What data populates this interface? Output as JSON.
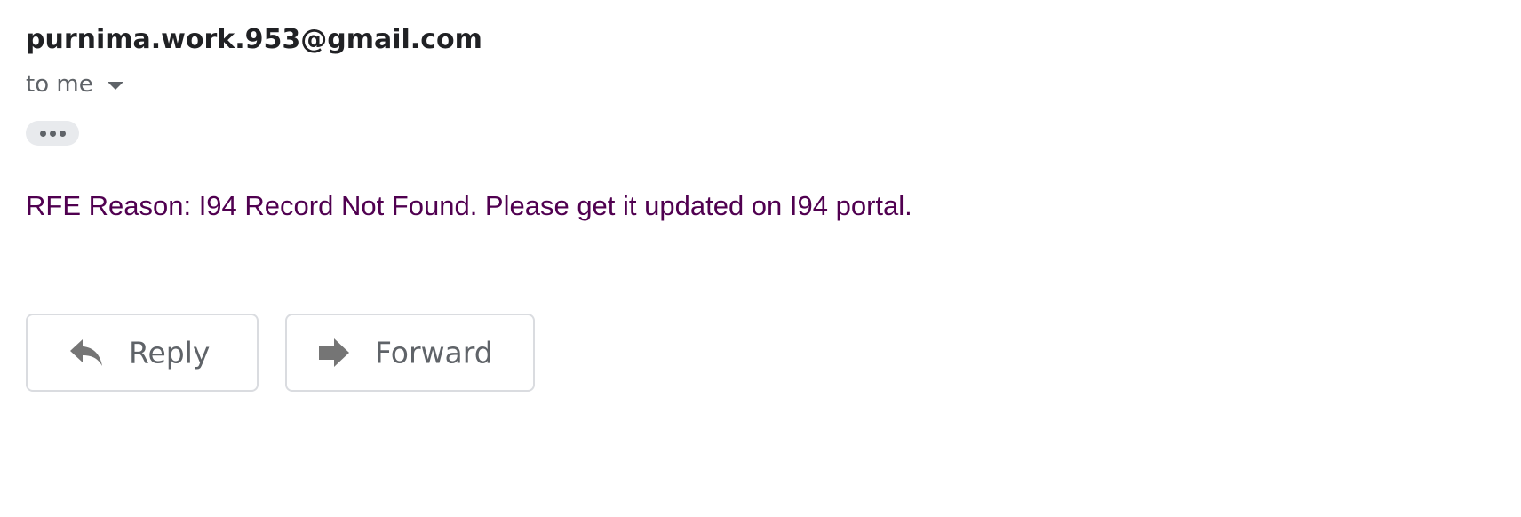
{
  "message": {
    "sender": "purnima.work.953@gmail.com",
    "recipient_label": "to me",
    "body": "RFE Reason: I94 Record Not Found. Please get it updated on I94 portal."
  },
  "actions": {
    "reply_label": "Reply",
    "forward_label": "Forward"
  },
  "icons": {
    "recipient_caret": "caret-down-icon",
    "trimmed_content": "more-horizontal-icon",
    "reply": "reply-arrow-icon",
    "forward": "forward-arrow-icon"
  },
  "colors": {
    "sender_text": "#202124",
    "secondary_text": "#5f6368",
    "body_text": "#500050",
    "button_border": "#dadce0",
    "trim_background": "#e8eaed",
    "icon": "#757575"
  }
}
